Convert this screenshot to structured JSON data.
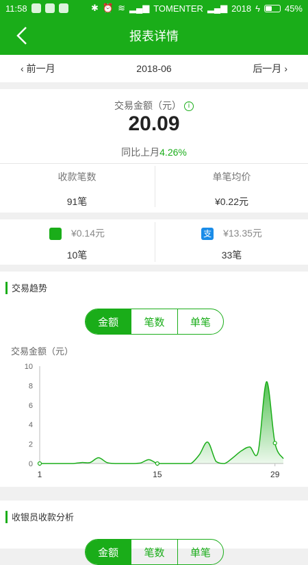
{
  "status_bar": {
    "time": "11:58",
    "carrier": "TOMENTER",
    "year": "2018",
    "battery": "45%",
    "battery_level": 0.45
  },
  "navbar": {
    "title": "报表详情"
  },
  "month_bar": {
    "prev": "前一月",
    "current": "2018-06",
    "next": "后一月"
  },
  "summary": {
    "amount_label": "交易金额（元）",
    "amount": "20.09",
    "yoy_label": "同比上月",
    "yoy_value": "4.26%",
    "count_label": "收款笔数",
    "count_value": "91笔",
    "avg_label": "单笔均价",
    "avg_value": "¥0.22元"
  },
  "payments": {
    "wechat_amount": "¥0.14元",
    "wechat_count": "10笔",
    "alipay_icon_text": "支",
    "alipay_amount": "¥13.35元",
    "alipay_count": "33笔"
  },
  "trend": {
    "title": "交易趋势",
    "tabs": [
      "金额",
      "笔数",
      "单笔"
    ],
    "active_tab": 0
  },
  "cashier": {
    "title": "收银员收款分析",
    "tabs": [
      "金额",
      "笔数",
      "单笔"
    ]
  },
  "colors": {
    "accent": "#1aad19",
    "alipay": "#1a8ce8"
  },
  "chart_data": {
    "type": "area",
    "ylabel": "交易金额（元）",
    "xlabel": "",
    "ylim": [
      0,
      10
    ],
    "yticks": [
      0,
      2,
      4,
      6,
      8,
      10
    ],
    "xticks": [
      1,
      15,
      29
    ],
    "xlim": [
      1,
      30
    ],
    "x": [
      1,
      2,
      3,
      4,
      5,
      6,
      7,
      8,
      9,
      10,
      11,
      12,
      13,
      14,
      15,
      16,
      17,
      18,
      19,
      20,
      21,
      22,
      23,
      24,
      25,
      26,
      27,
      28,
      29,
      30
    ],
    "values": [
      0,
      0,
      0,
      0,
      0,
      0.1,
      0.1,
      0.6,
      0.1,
      0,
      0,
      0,
      0.05,
      0.4,
      0,
      0,
      0,
      0,
      0,
      0.9,
      2.2,
      0.2,
      0,
      0.6,
      1.3,
      1.7,
      1.2,
      8.4,
      2.1,
      0.5
    ],
    "markers": [
      1,
      15,
      29
    ]
  }
}
